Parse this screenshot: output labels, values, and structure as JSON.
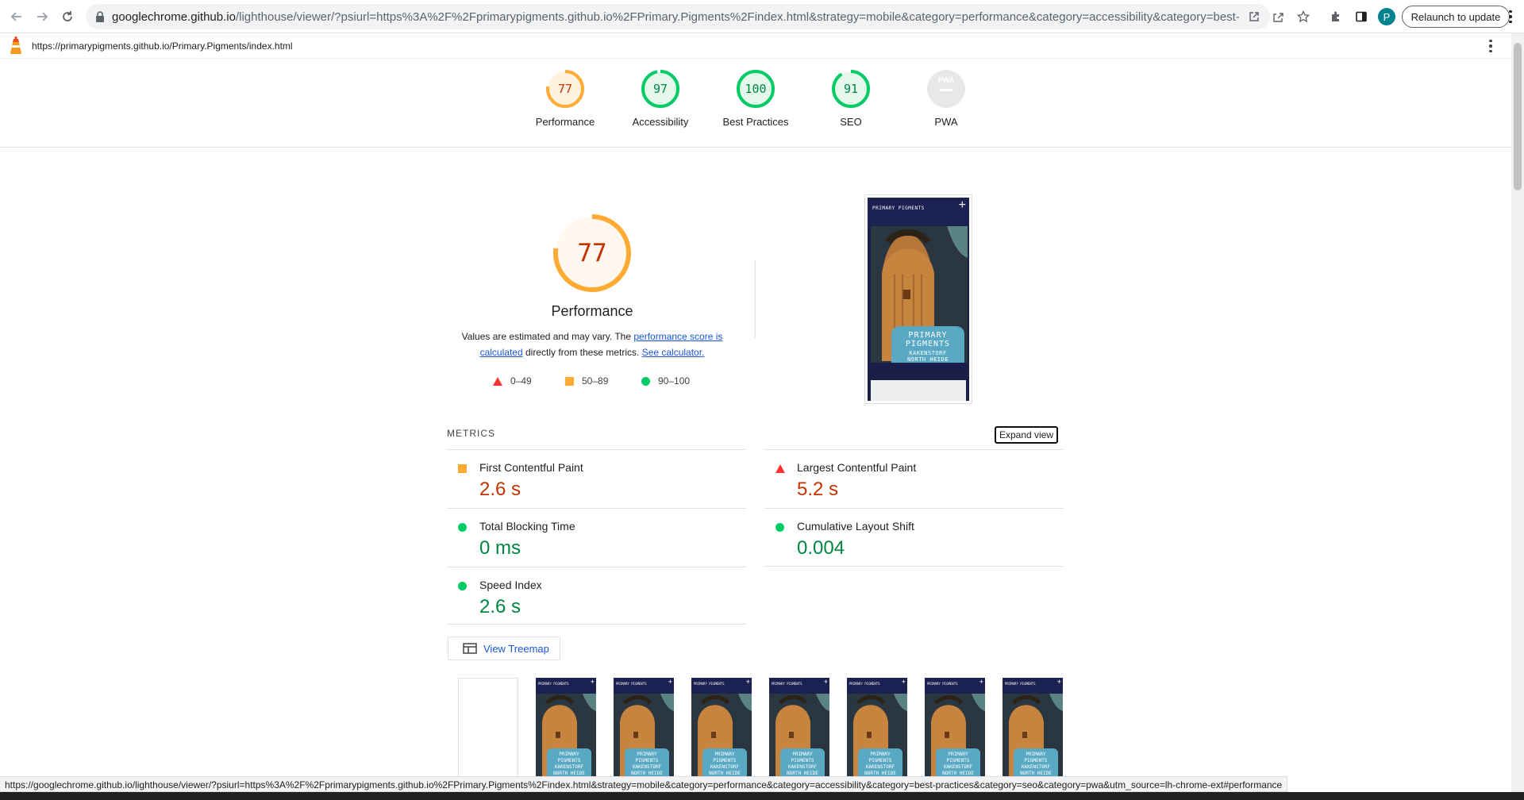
{
  "browser": {
    "url_host": "googlechrome.github.io",
    "url_path": "/lighthouse/viewer/?psiurl=https%3A%2F%2Fprimarypigments.github.io%2FPrimary.Pigments%2Findex.html&strategy=mobile&category=performance&category=accessibility&category=best-practices&...",
    "profile_initial": "P",
    "relaunch_label": "Relaunch to update"
  },
  "lighthouse": {
    "page_url": "https://primarypigments.github.io/Primary.Pigments/index.html"
  },
  "scores": [
    {
      "value": "77",
      "label": "Performance",
      "color": "#fa3",
      "fraction": 0.77
    },
    {
      "value": "97",
      "label": "Accessibility",
      "color": "#0c6",
      "fraction": 0.97
    },
    {
      "value": "100",
      "label": "Best Practices",
      "color": "#0c6",
      "fraction": 1.0
    },
    {
      "value": "91",
      "label": "SEO",
      "color": "#0c6",
      "fraction": 0.91
    },
    {
      "value": "PWA",
      "label": "PWA"
    }
  ],
  "performance": {
    "score": "77",
    "title": "Performance",
    "desc_prefix": "Values are estimated and may vary. The ",
    "desc_link1": "performance score is calculated",
    "desc_middle": " directly from these metrics. ",
    "desc_link2": "See calculator.",
    "legend": [
      {
        "range": "0–49",
        "shape": "triangle",
        "color": "#f33"
      },
      {
        "range": "50–89",
        "shape": "square",
        "color": "#fa3"
      },
      {
        "range": "90–100",
        "shape": "circle",
        "color": "#0c6"
      }
    ]
  },
  "screenshot": {
    "brand": "PRIMARY PIGMENTS",
    "card_line1": "PRIMARY",
    "card_line2": "PIGMENTS",
    "card_line3": "KAKENSTORF",
    "card_line4": "NORTH HEIDE"
  },
  "metrics": {
    "title": "METRICS",
    "expand_label": "Expand view",
    "items": [
      {
        "label": "First Contentful Paint",
        "value": "2.6 s",
        "status": "average"
      },
      {
        "label": "Largest Contentful Paint",
        "value": "5.2 s",
        "status": "fail"
      },
      {
        "label": "Total Blocking Time",
        "value": "0 ms",
        "status": "pass"
      },
      {
        "label": "Cumulative Layout Shift",
        "value": "0.004",
        "status": "pass"
      },
      {
        "label": "Speed Index",
        "value": "2.6 s",
        "status": "pass"
      }
    ]
  },
  "treemap_label": "View Treemap",
  "statusbar_text": "https://googlechrome.github.io/lighthouse/viewer/?psiurl=https%3A%2F%2Fprimarypigments.github.io%2FPrimary.Pigments%2Findex.html&strategy=mobile&category=performance&category=accessibility&category=best-practices&category=seo&category=pwa&utm_source=lh-chrome-ext#performance"
}
